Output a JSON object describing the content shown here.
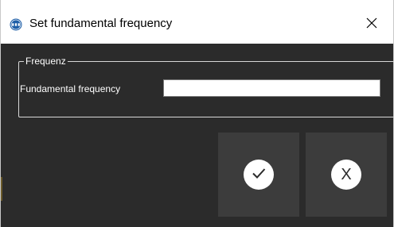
{
  "window": {
    "title": "Set fundamental frequency",
    "app_icon": "pce-logo-icon",
    "close_icon": "close-icon"
  },
  "group": {
    "legend": "Frequenz",
    "field_label": "Fundamental frequency",
    "field_value": "",
    "field_placeholder": ""
  },
  "buttons": {
    "ok_icon": "checkmark-icon",
    "cancel_icon": "x-icon",
    "cancel_glyph": "X"
  },
  "colors": {
    "client_background": "#2b2b2b",
    "button_background": "#3c3c3c",
    "icon_circle": "#ffffff",
    "app_icon_blue": "#1f5fa8"
  }
}
